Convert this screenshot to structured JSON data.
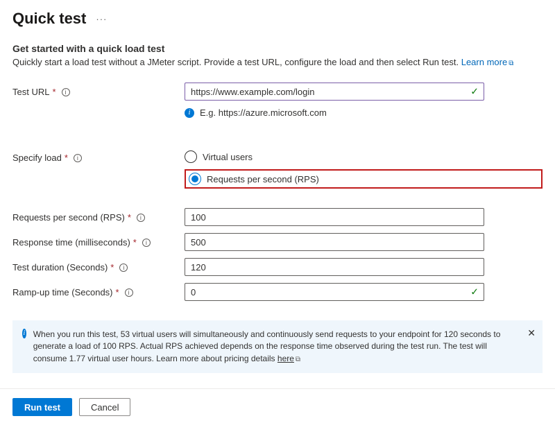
{
  "header": {
    "title": "Quick test"
  },
  "intro": {
    "subhead": "Get started with a quick load test",
    "desc_prefix": "Quickly start a load test without a JMeter script. Provide a test URL, configure the load and then select Run test. ",
    "learn_more": "Learn more"
  },
  "fields": {
    "test_url": {
      "label": "Test URL",
      "value": "https://www.example.com/login",
      "example": "E.g. https://azure.microsoft.com"
    },
    "specify_load": {
      "label": "Specify load",
      "options": {
        "vu": "Virtual users",
        "rps": "Requests per second (RPS)"
      },
      "selected": "rps"
    },
    "rps": {
      "label": "Requests per second (RPS)",
      "value": "100"
    },
    "response_time": {
      "label": "Response time (milliseconds)",
      "value": "500"
    },
    "duration": {
      "label": "Test duration (Seconds)",
      "value": "120"
    },
    "rampup": {
      "label": "Ramp-up time (Seconds)",
      "value": "0"
    }
  },
  "banner": {
    "text_prefix": "When you run this test, 53 virtual users will simultaneously and continuously send requests to your endpoint for 120 seconds to generate a load of 100 RPS. Actual RPS achieved depends on the response time observed during the test run. The test will consume 1.77 virtual user hours. Learn more about pricing details ",
    "link": "here"
  },
  "footer": {
    "run": "Run test",
    "cancel": "Cancel"
  }
}
